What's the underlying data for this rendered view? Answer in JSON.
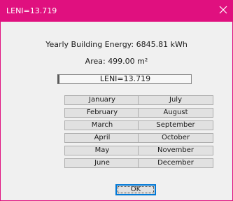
{
  "window": {
    "title": "LENI=13.719",
    "accent_color": "#e0107f",
    "close_icon": "close-icon"
  },
  "summary": {
    "yearly_energy": "Yearly Building Energy: 6845.81 kWh",
    "area": "Area: 499.00 m²",
    "leni_value": "LENI=13.719"
  },
  "months": {
    "left": [
      "January",
      "February",
      "March",
      "April",
      "May",
      "June"
    ],
    "right": [
      "July",
      "August",
      "September",
      "October",
      "November",
      "December"
    ]
  },
  "buttons": {
    "ok_label": "OK"
  }
}
